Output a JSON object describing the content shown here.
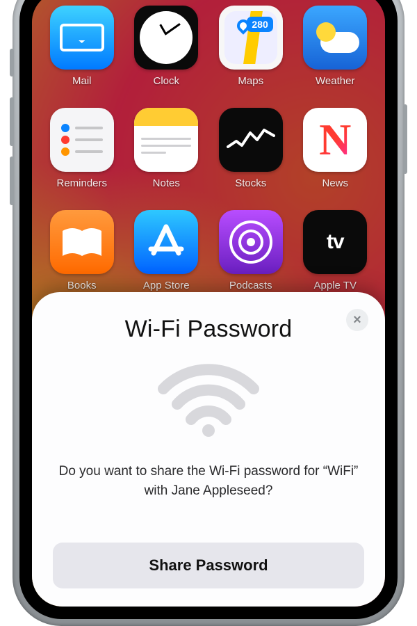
{
  "apps": {
    "mail": {
      "label": "Mail"
    },
    "clock": {
      "label": "Clock"
    },
    "maps": {
      "label": "Maps",
      "badge": "280"
    },
    "weather": {
      "label": "Weather"
    },
    "reminders": {
      "label": "Reminders"
    },
    "notes": {
      "label": "Notes"
    },
    "stocks": {
      "label": "Stocks"
    },
    "news": {
      "label": "News"
    },
    "books": {
      "label": "Books"
    },
    "appstore": {
      "label": "App Store"
    },
    "podcasts": {
      "label": "Podcasts"
    },
    "tv": {
      "label": "Apple TV",
      "glyph": "tv"
    }
  },
  "sheet": {
    "title": "Wi-Fi Password",
    "message": "Do you want to share the Wi-Fi password for “WiFi” with Jane Appleseed?",
    "share_label": "Share Password",
    "close_label": "×"
  }
}
